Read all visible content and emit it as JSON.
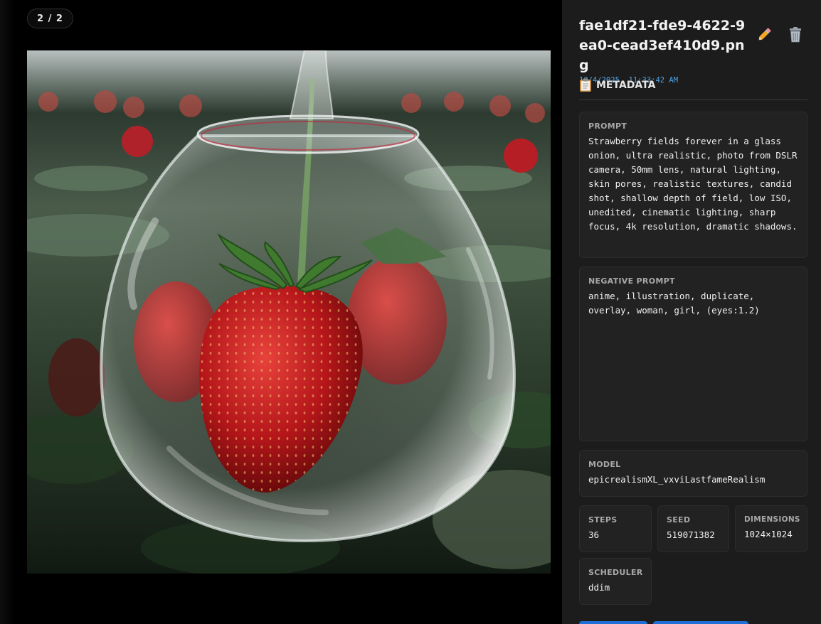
{
  "viewer": {
    "counter": "2 / 2"
  },
  "details": {
    "filename": "fae1df21-fde9-4622-9ea0-cead3ef410d9.png",
    "timestamp": "10/4/2025, 11:33:42 AM",
    "edit_icon": "pencil-icon",
    "delete_icon": "trash-icon"
  },
  "metadata": {
    "heading": "METADATA",
    "heading_icon": "clipboard-icon",
    "prompt_label": "PROMPT",
    "prompt": "Strawberry fields forever in a glass onion, ultra realistic, photo from DSLR camera, 50mm lens, natural lighting, skin pores, realistic textures, candid shot, shallow depth of field, low ISO, unedited, cinematic lighting, sharp focus, 4k resolution, dramatic shadows.",
    "negative_label": "NEGATIVE PROMPT",
    "negative": "anime, illustration, duplicate, overlay, woman, girl, (eyes:1.2)",
    "model_label": "MODEL",
    "model": "epicrealismXL_vxviLastfameRealism",
    "steps_label": "STEPS",
    "steps": "36",
    "seed_label": "SEED",
    "seed": "519071382",
    "dimensions_label": "DIMENSIONS",
    "dimensions": "1024×1024",
    "scheduler_label": "SCHEDULER",
    "scheduler": "ddim"
  },
  "colors": {
    "accent": "#4fa3e6",
    "button": "#1f6fd6",
    "panel": "#1c1c1c"
  }
}
